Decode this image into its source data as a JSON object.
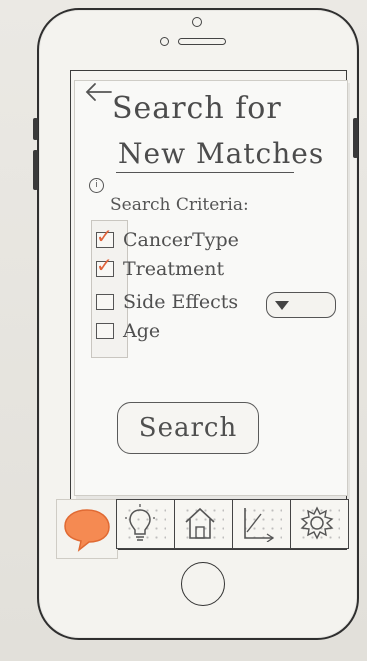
{
  "header": {
    "title_line1": "Search for",
    "title_line2": "New Matches"
  },
  "criteria": {
    "info_glyph": "i",
    "label": "Search Criteria:",
    "items": [
      {
        "label": "CancerType",
        "checked": true
      },
      {
        "label": "Treatment",
        "checked": true
      },
      {
        "label": "Side Effects",
        "checked": false
      },
      {
        "label": "Age",
        "checked": false
      }
    ]
  },
  "check_mark": "✓",
  "search_button": {
    "label": "Search"
  },
  "nav": {
    "tabs": [
      {
        "name": "chat",
        "icon": "chat-bubble-icon",
        "active": true,
        "color": "#f58a52"
      },
      {
        "name": "ideas",
        "icon": "lightbulb-icon"
      },
      {
        "name": "home",
        "icon": "home-icon"
      },
      {
        "name": "progress",
        "icon": "chart-icon"
      },
      {
        "name": "settings",
        "icon": "gear-icon"
      }
    ]
  },
  "colors": {
    "accent": "#f58a52",
    "check": "#e0623a",
    "ink": "#4c4c4c"
  }
}
